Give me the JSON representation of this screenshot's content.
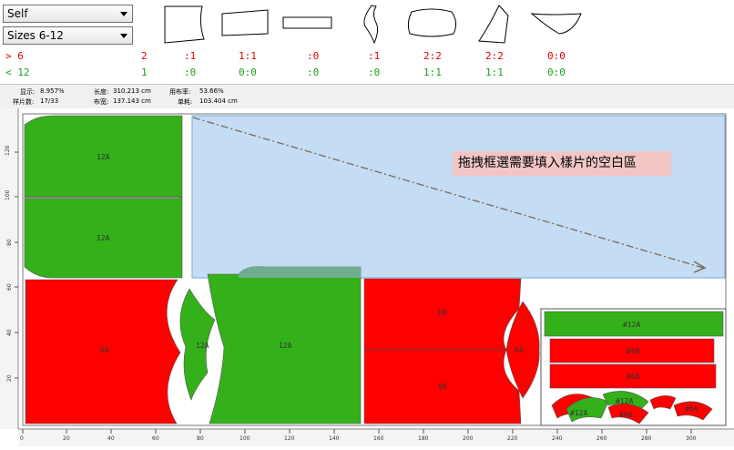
{
  "toolbar": {
    "type_select": "Self",
    "size_select": "Sizes 6-12"
  },
  "size_rows": {
    "row1_label": "> 6",
    "row2_label": "< 12",
    "row1": [
      "2",
      ":1",
      "1:1",
      ":0",
      ":1",
      "2:2",
      "2:2",
      "0:0"
    ],
    "row2": [
      "1",
      ":0",
      "0:0",
      ":0",
      ":0",
      "1:1",
      "1:1",
      "0:0"
    ]
  },
  "info": {
    "display_label": "显示:",
    "display_value": "8.957%",
    "pieces_label": "样片数:",
    "pieces_value": "17/33",
    "length_label": "长度:",
    "length_value": "310.213 cm",
    "width_label": "布宽:",
    "width_value": "137.143 cm",
    "usage_label": "用布率:",
    "usage_value": "53.66%",
    "unit_label": "单耗:",
    "unit_value": "103.404 cm"
  },
  "tooltip": "拖拽框選需要填入樣片的空白區",
  "pieces": {
    "p1": "12A",
    "p2": "12A",
    "p3": "6A",
    "p4": "12A",
    "p5": "12A",
    "p6": "6B",
    "p7": "6B",
    "p8": "6A",
    "mini1": "#12A",
    "mini2": "#6B",
    "mini3": "#6A",
    "mini4": "#12A",
    "mini5": "#12A",
    "mini6": "#6B",
    "mini7": "#6A"
  },
  "ruler": {
    "x_ticks": [
      "0",
      "20",
      "40",
      "60",
      "80",
      "100",
      "120",
      "140",
      "160",
      "180",
      "200",
      "220",
      "240",
      "260",
      "280",
      "300"
    ],
    "y_ticks": [
      "120",
      "100",
      "80",
      "60",
      "40",
      "20"
    ]
  },
  "colors": {
    "green": "#33b01a",
    "red": "#ff0000",
    "selection": "#c4dcf4"
  }
}
